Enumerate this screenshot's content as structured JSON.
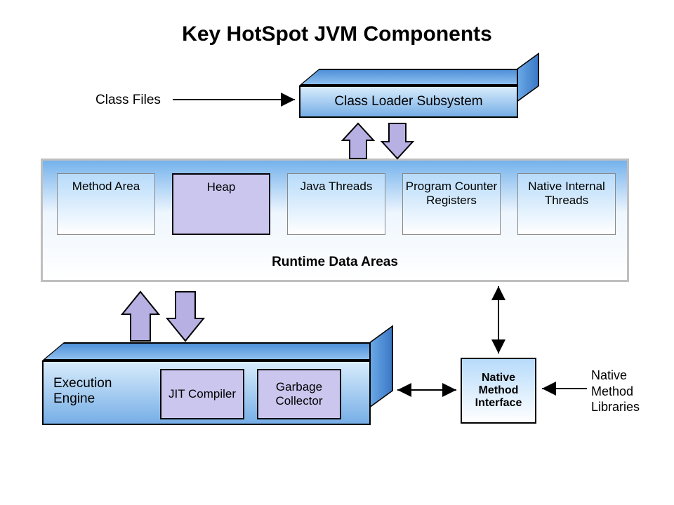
{
  "title": "Key HotSpot JVM Components",
  "class_files_label": "Class Files",
  "class_loader_label": "Class Loader Subsystem",
  "runtime_data_areas": {
    "label": "Runtime Data Areas",
    "method_area": "Method Area",
    "heap": "Heap",
    "java_threads": "Java Threads",
    "pc_registers": "Program Counter Registers",
    "native_threads": "Native Internal Threads"
  },
  "execution_engine": {
    "label": "Execution Engine",
    "jit": "JIT Compiler",
    "gc": "Garbage Collector"
  },
  "native_method_interface": "Native Method Interface",
  "native_method_libraries": "Native Method Libraries",
  "arrows": {
    "class_files_to_loader": "right-arrow",
    "loader_to_rda": "bidirectional-block-arrows",
    "rda_to_exec": "bidirectional-block-arrows",
    "exec_to_nmi": "bidirectional-thin-arrow",
    "rda_to_nmi": "bidirectional-thin-arrow",
    "libs_to_nmi": "left-arrow"
  },
  "colors": {
    "box_fill_light": "#d8ecfc",
    "box_fill_dark": "#76aee6",
    "heap_fill": "#cac6ee",
    "block_arrow_fill": "#b7b0e3",
    "border": "#000000"
  }
}
